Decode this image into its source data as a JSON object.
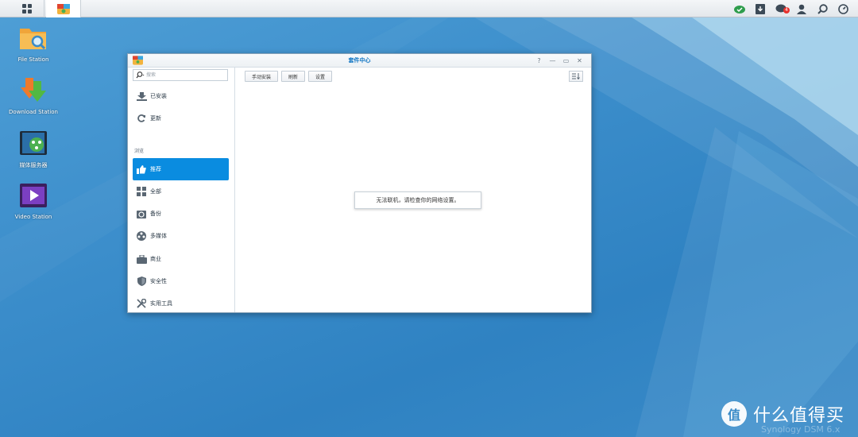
{
  "taskbar": {
    "apps": [
      "main-menu",
      "package-center"
    ],
    "right_icons": [
      "cloud-check-icon",
      "download-tray-icon",
      "chat-icon",
      "user-icon",
      "search-icon",
      "dashboard-icon"
    ],
    "chat_badge": "4"
  },
  "desktop": {
    "icons": [
      {
        "label": "File Station",
        "icon": "folder-icon"
      },
      {
        "label": "Download Station",
        "icon": "download-icon"
      },
      {
        "label": "媒体服务器",
        "icon": "media-server-icon"
      },
      {
        "label": "Video Station",
        "icon": "video-icon"
      }
    ]
  },
  "window": {
    "title": "套件中心",
    "controls": [
      "?",
      "—",
      "▭",
      "✕"
    ],
    "search": {
      "placeholder": "搜索",
      "value": ""
    },
    "sidebar": {
      "top_items": [
        {
          "label": "已安装",
          "icon": "installed-icon"
        },
        {
          "label": "更新",
          "icon": "refresh-icon"
        }
      ],
      "section_label": "浏览",
      "browse_items": [
        {
          "label": "推荐",
          "icon": "thumbs-up-icon",
          "active": true
        },
        {
          "label": "全部",
          "icon": "grid-icon"
        },
        {
          "label": "备份",
          "icon": "backup-icon"
        },
        {
          "label": "多媒体",
          "icon": "film-reel-icon"
        },
        {
          "label": "商业",
          "icon": "briefcase-icon"
        },
        {
          "label": "安全性",
          "icon": "shield-icon"
        },
        {
          "label": "实用工具",
          "icon": "tools-icon"
        }
      ]
    },
    "toolbar": {
      "manual_install": "手动安装",
      "refresh": "刷新",
      "settings": "设置"
    },
    "message": "无法联机，请检查你的网络设置。"
  },
  "watermark": {
    "logo_char": "值",
    "text": "什么值得买",
    "faint_text": "Synology DSM 6.x"
  },
  "colors": {
    "accent": "#0a8ce0",
    "desktop_bg": "#3d8fcc"
  }
}
